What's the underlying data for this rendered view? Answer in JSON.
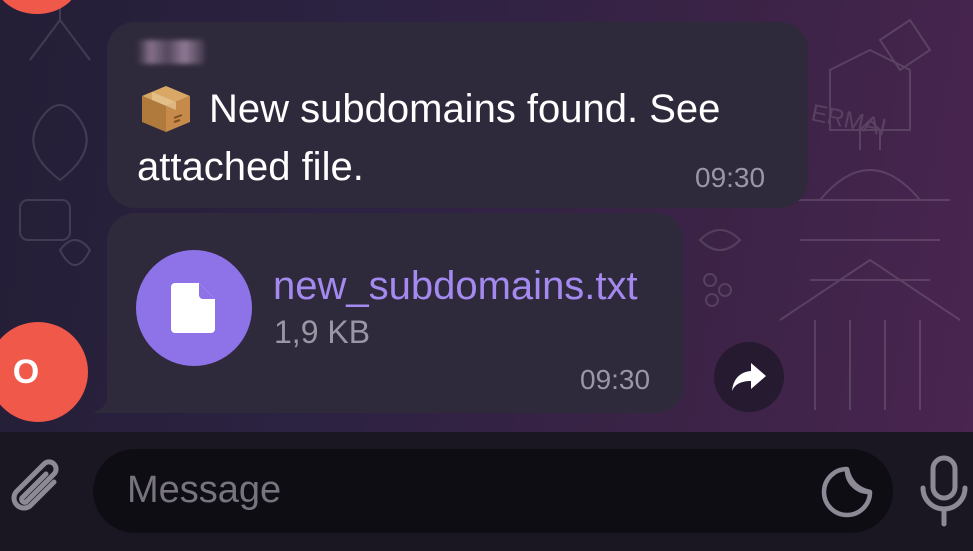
{
  "chat": {
    "messages": [
      {
        "text": "New subdomains found. See attached file.",
        "time": "09:30",
        "emoji_icon": "package-icon"
      },
      {
        "file": {
          "name": "new_subdomains.txt",
          "size": "1,9 KB",
          "icon": "document-icon"
        },
        "time": "09:30"
      }
    ],
    "sender_avatar": {
      "initial": "O",
      "color": "#f0594a"
    }
  },
  "composer": {
    "placeholder": "Message",
    "attach_icon": "paperclip-icon",
    "sticker_icon": "sticker-icon",
    "mic_icon": "microphone-icon"
  },
  "colors": {
    "bubble": "#2f2a3b",
    "accent": "#8e72e8",
    "link": "#a48af0",
    "timestamp": "#9a96a6",
    "avatar": "#f0594a"
  }
}
